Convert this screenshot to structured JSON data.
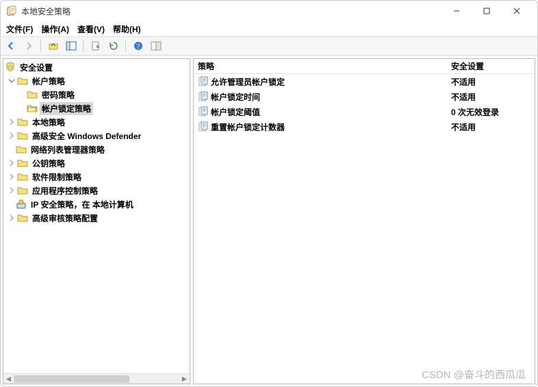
{
  "window": {
    "title": "本地安全策略"
  },
  "menu": {
    "file": "文件(F)",
    "action": "操作(A)",
    "view": "查看(V)",
    "help": "帮助(H)"
  },
  "tree": {
    "root": "安全设置",
    "account_policy": "帐户策略",
    "password_policy": "密码策略",
    "lockout_policy": "帐户锁定策略",
    "local_policy": "本地策略",
    "defender": "高级安全 Windows Defender",
    "network_list": "网络列表管理器策略",
    "pubkey": "公钥策略",
    "software_restrict": "软件限制策略",
    "app_control": "应用程序控制策略",
    "ipsec": "IP 安全策略，在 本地计算机",
    "audit_config": "高级审核策略配置"
  },
  "list": {
    "col_policy": "策略",
    "col_setting": "安全设置",
    "rows": [
      {
        "policy": "允许管理员帐户锁定",
        "setting": "不适用"
      },
      {
        "policy": "帐户锁定时间",
        "setting": "不适用"
      },
      {
        "policy": "帐户锁定阈值",
        "setting": "0 次无效登录"
      },
      {
        "policy": "重置帐户锁定计数器",
        "setting": "不适用"
      }
    ]
  },
  "watermark": "CSDN @奋斗的西瓜瓜"
}
